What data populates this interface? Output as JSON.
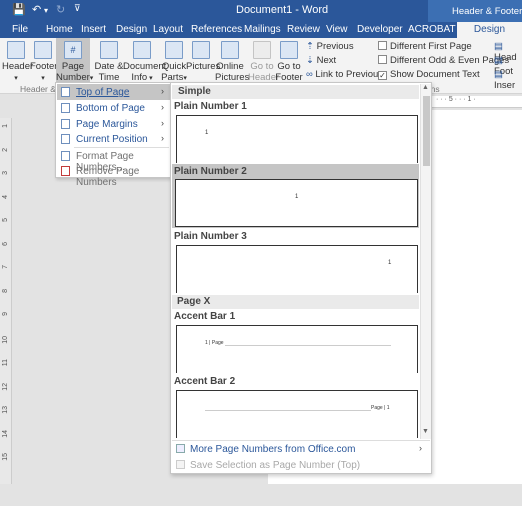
{
  "window": {
    "title": "Document1 - Word",
    "tools_label": "Header & Footer Tools"
  },
  "qat": {
    "save": "💾",
    "undo": "↶",
    "undo_arrow": "▾",
    "redo": "↻",
    "customize": "⊽"
  },
  "tabs": [
    "File",
    "Home",
    "Insert",
    "Design",
    "Layout",
    "References",
    "Mailings",
    "Review",
    "View",
    "Developer",
    "ACROBAT"
  ],
  "active_tab": "Design",
  "ribbon": {
    "header": "Header",
    "footer": "Footer",
    "page_number_1": "Page",
    "page_number_2": "Number",
    "date_time_1": "Date &",
    "date_time_2": "Time",
    "doc_info_1": "Document",
    "doc_info_2": "Info",
    "quick_parts_1": "Quick",
    "quick_parts_2": "Parts",
    "pictures": "Pictures",
    "online_pictures_1": "Online",
    "online_pictures_2": "Pictures",
    "goto_header_1": "Go to",
    "goto_header_2": "Header",
    "goto_footer_1": "Go to",
    "goto_footer_2": "Footer",
    "previous": "Previous",
    "next": "Next",
    "link_previous": "Link to Previous",
    "diff_first_page": "Different First Page",
    "diff_odd_even": "Different Odd & Even Pages",
    "show_doc_text": "Show Document Text",
    "header_pos": "Head",
    "footer_pos": "Foot",
    "insert_align": "Inser",
    "group_hf": "Header & F",
    "group_options": "ions"
  },
  "menu": [
    {
      "label": "Top of Page",
      "submenu": true,
      "selected": true
    },
    {
      "label": "Bottom of Page",
      "submenu": true,
      "selected": false
    },
    {
      "label": "Page Margins",
      "submenu": true,
      "selected": false
    },
    {
      "label": "Current Position",
      "submenu": true,
      "selected": false
    },
    {
      "label": "Format Page Numbers...",
      "submenu": false,
      "selected": false
    },
    {
      "label": "Remove Page Numbers",
      "submenu": false,
      "selected": false
    }
  ],
  "gallery": {
    "section_simple": "Simple",
    "section_pagex": "Page X",
    "items": [
      {
        "name": "Plain Number 1",
        "sample": "1"
      },
      {
        "name": "Plain Number 2",
        "sample": "1"
      },
      {
        "name": "Plain Number 3",
        "sample": "1"
      },
      {
        "name": "Accent Bar 1",
        "sample": "1 | Page"
      },
      {
        "name": "Accent Bar 2",
        "sample": "Page | 1"
      }
    ],
    "more_label": "More Page Numbers from Office.com",
    "save_label": "Save Selection as Page Number (Top)"
  },
  "ruler_numbers": [
    "1",
    "2",
    "3",
    "4",
    "5",
    "6",
    "7",
    "8",
    "9",
    "10",
    "11",
    "12",
    "13",
    "14",
    "15"
  ],
  "ruler_top": "· · · 5 · · · 1 ·"
}
